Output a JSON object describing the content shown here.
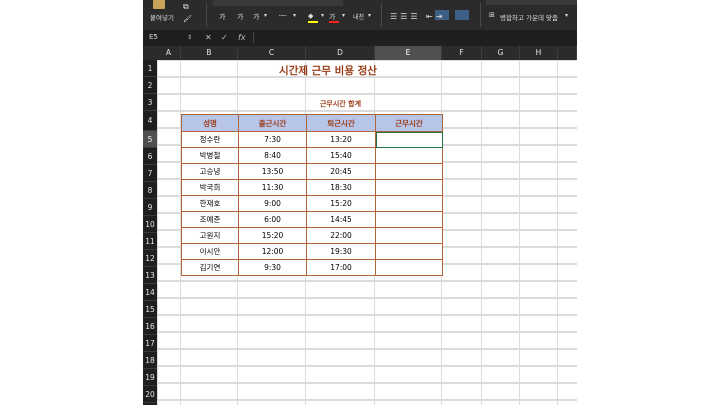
{
  "ribbon": {
    "paste_label": "붙여넣기",
    "format_buttons": [
      "가",
      "가",
      "가"
    ],
    "fill_button": "가",
    "char_button": "내천",
    "merge_label": "병합하고 가운데 맞춤"
  },
  "formula_bar": {
    "name_box": "E5",
    "cancel": "✕",
    "confirm": "✓",
    "fx": "fx",
    "value": ""
  },
  "grid": {
    "columns": [
      "A",
      "B",
      "C",
      "D",
      "E",
      "F",
      "G",
      "H"
    ],
    "rows": [
      "1",
      "2",
      "3",
      "4",
      "5",
      "6",
      "7",
      "8",
      "9",
      "10",
      "11",
      "12",
      "13",
      "14",
      "15",
      "16",
      "17",
      "18",
      "19",
      "20"
    ],
    "selected_column": "E",
    "selected_row": "5"
  },
  "sheet": {
    "title": "시간제 근무 비용 정산",
    "subtitle": "근무시간 합계",
    "headers": [
      "성명",
      "출근시간",
      "퇴근시간",
      "근무시간"
    ],
    "rows": [
      {
        "name": "정수란",
        "in": "7:30",
        "out": "13:20",
        "hours": ""
      },
      {
        "name": "박병철",
        "in": "8:40",
        "out": "15:40",
        "hours": ""
      },
      {
        "name": "고승녕",
        "in": "13:50",
        "out": "20:45",
        "hours": ""
      },
      {
        "name": "박국희",
        "in": "11:30",
        "out": "18:30",
        "hours": ""
      },
      {
        "name": "한재호",
        "in": "9:00",
        "out": "15:20",
        "hours": ""
      },
      {
        "name": "조예준",
        "in": "6:00",
        "out": "14:45",
        "hours": ""
      },
      {
        "name": "고원지",
        "in": "15:20",
        "out": "22:00",
        "hours": ""
      },
      {
        "name": "이시안",
        "in": "12:00",
        "out": "19:30",
        "hours": ""
      },
      {
        "name": "김기연",
        "in": "9:30",
        "out": "17:00",
        "hours": ""
      }
    ]
  },
  "colors": {
    "header_fill": "#b7c5e8",
    "accent_text": "#9a3d17",
    "table_border": "#b0643a",
    "active_cell": "#217346"
  }
}
